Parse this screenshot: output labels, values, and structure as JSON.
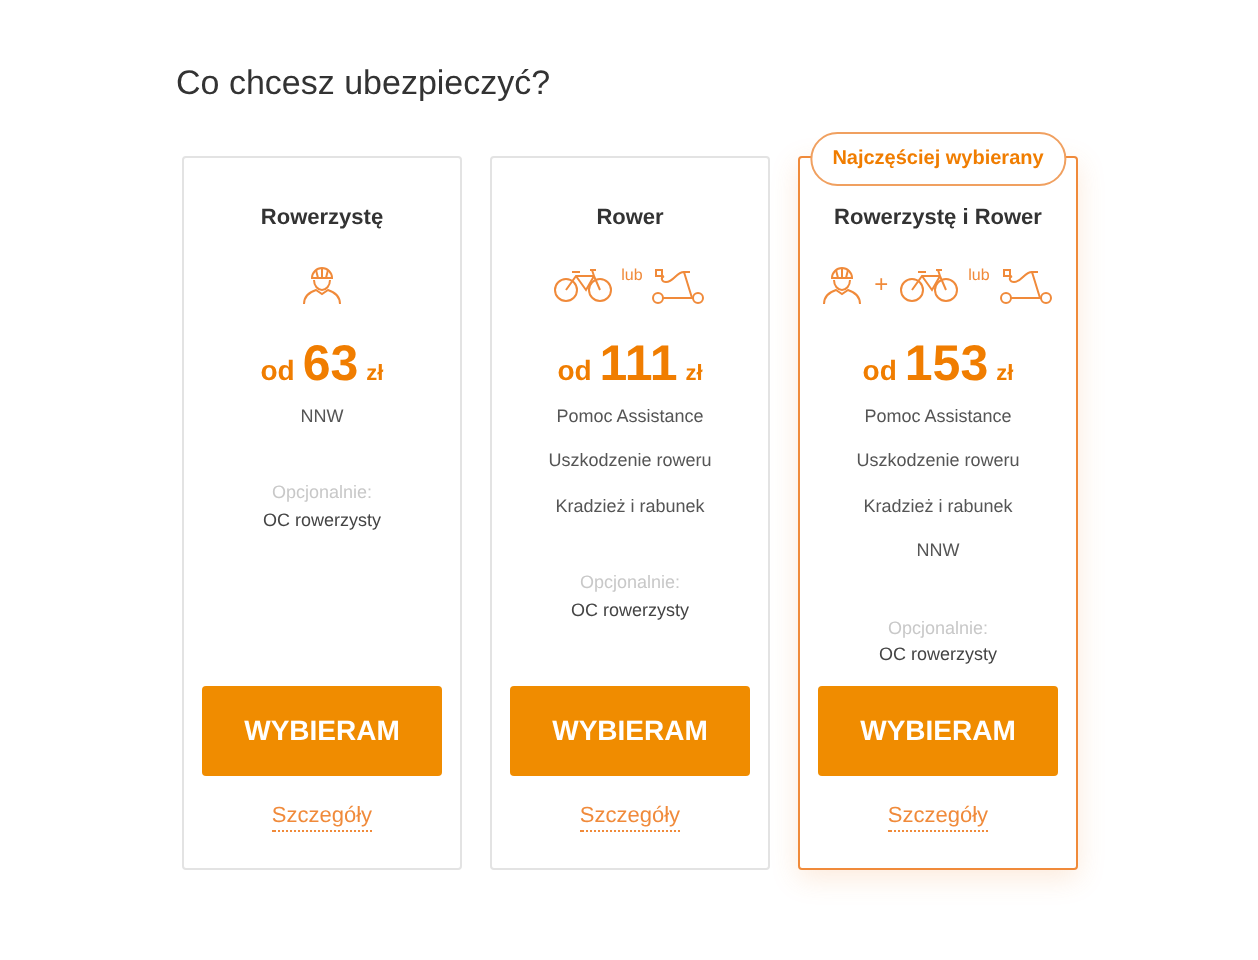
{
  "heading": "Co chcesz ubezpieczyć?",
  "cards": [
    {
      "title": "Rowerzystę",
      "highlighted": false,
      "icons": [
        {
          "kind": "cyclist"
        }
      ],
      "price": {
        "prefix": "od",
        "amount": "63",
        "currency": "zł"
      },
      "features": [
        "NNW"
      ],
      "optional_label": "Opcjonalnie:",
      "optional": "OC rowerzysty",
      "button": "WYBIERAM",
      "link": "Szczegóły"
    },
    {
      "title": "Rower",
      "highlighted": false,
      "icons": [
        {
          "kind": "bicycle"
        },
        {
          "kind": "text",
          "text": "lub"
        },
        {
          "kind": "scooter"
        }
      ],
      "price": {
        "prefix": "od",
        "amount": "111",
        "currency": "zł"
      },
      "features": [
        "Pomoc Assistance",
        "Uszkodzenie roweru",
        "Kradzież i rabunek"
      ],
      "optional_label": "Opcjonalnie:",
      "optional": "OC rowerzysty",
      "button": "WYBIERAM",
      "link": "Szczegóły"
    },
    {
      "title": "Rowerzystę i Rower",
      "highlighted": true,
      "badge": "Najczęściej wybierany",
      "icons": [
        {
          "kind": "cyclist"
        },
        {
          "kind": "text",
          "text": "+"
        },
        {
          "kind": "bicycle"
        },
        {
          "kind": "text",
          "text": "lub"
        },
        {
          "kind": "scooter"
        }
      ],
      "price": {
        "prefix": "od",
        "amount": "153",
        "currency": "zł"
      },
      "features": [
        "Pomoc Assistance",
        "Uszkodzenie roweru",
        "Kradzież i rabunek",
        "NNW"
      ],
      "optional_label": "Opcjonalnie:",
      "optional": "OC rowerzysty",
      "button": "WYBIERAM",
      "link": "Szczegóły"
    }
  ]
}
